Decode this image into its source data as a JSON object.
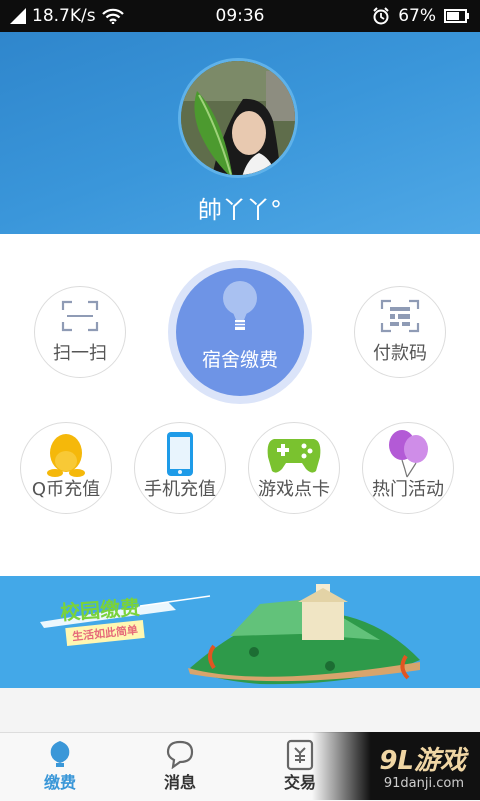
{
  "status": {
    "speed": "18.7K/s",
    "time": "09:36",
    "battery": "67%"
  },
  "profile": {
    "name": "帥丫丫°"
  },
  "services": {
    "scan": "扫一扫",
    "dorm_pay": "宿舍缴费",
    "pay_code": "付款码",
    "qcoin": "Q币充值",
    "phone": "手机充值",
    "game": "游戏点卡",
    "events": "热门活动"
  },
  "banner": {
    "title": "校园缴费",
    "subtitle": "生活如此简单"
  },
  "tabs": [
    {
      "label": "缴费",
      "active": true
    },
    {
      "label": "消息",
      "active": false
    },
    {
      "label": "交易",
      "active": false
    }
  ],
  "watermark": {
    "logo": "9L游戏",
    "site": "91danji.com"
  },
  "colors": {
    "accent": "#3a97d8",
    "primary_circle": "#6e94e6",
    "header": "#3a96da"
  }
}
